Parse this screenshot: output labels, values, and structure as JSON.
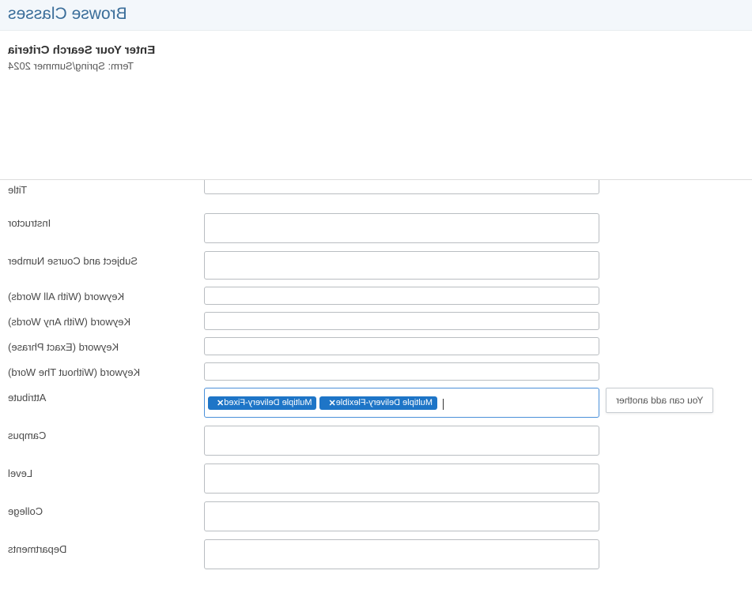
{
  "header": {
    "title": "Browse Classes"
  },
  "subheader": {
    "title": "Enter Your Search Criteria",
    "term": "Term: Spring/Summer 2024"
  },
  "labels": {
    "title": "Title",
    "instructor": "Instructor",
    "subject_course_number": "Subject and Course Number",
    "keyword_all": "Keyword (With All Words)",
    "keyword_any": "Keyword (With Any Words)",
    "keyword_exact": "Keyword (Exact Phrase)",
    "keyword_without": "Keyword (Without The Word)",
    "attribute": "Attribute",
    "campus": "Campus",
    "level": "Level",
    "college": "College",
    "departments": "Departments"
  },
  "attribute": {
    "tags": [
      "Multiple Delivery-Fixed",
      "Multiple Delivery-Flexible"
    ]
  },
  "hint": {
    "text": "You can add another"
  }
}
